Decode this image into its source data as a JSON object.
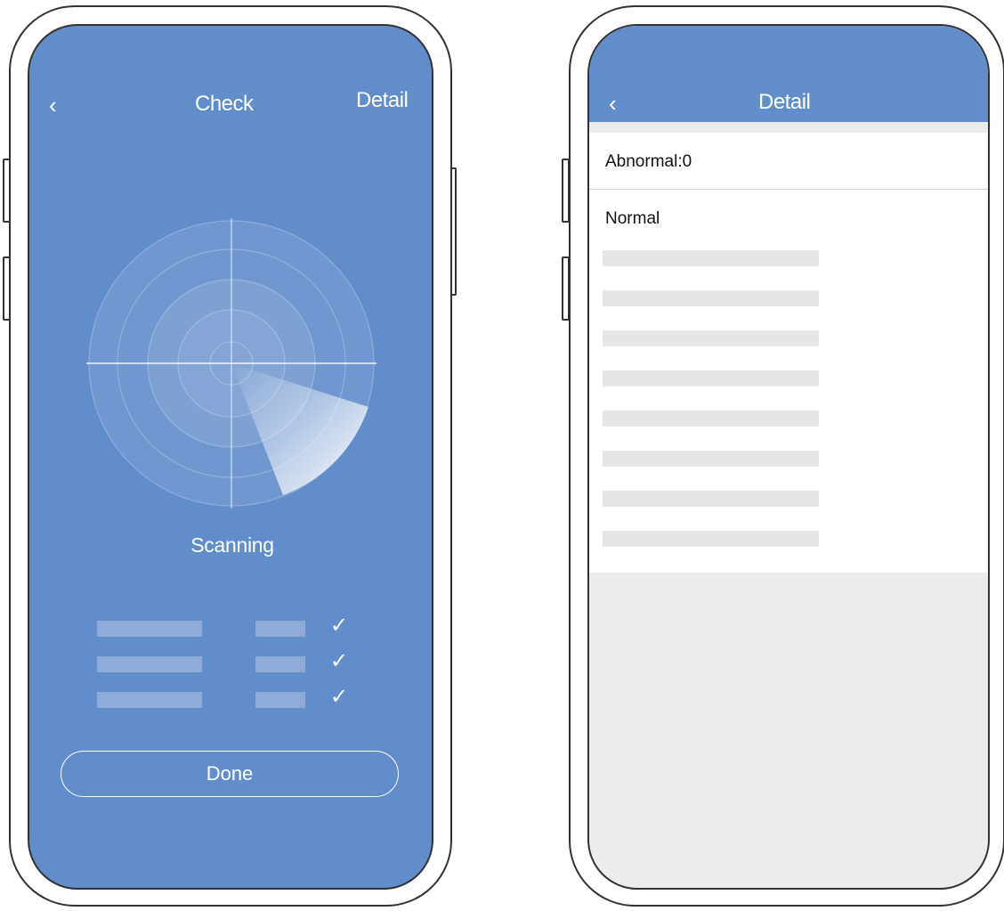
{
  "left_screen": {
    "nav": {
      "back_icon": "chevron-left-icon",
      "back_glyph": "‹",
      "title": "Check",
      "detail_link": "Detail"
    },
    "scanning_label": "Scanning",
    "check_items": [
      {
        "check_icon": "check-icon",
        "glyph": "✓"
      },
      {
        "check_icon": "check-icon",
        "glyph": "✓"
      },
      {
        "check_icon": "check-icon",
        "glyph": "✓"
      }
    ],
    "done_button": "Done"
  },
  "right_screen": {
    "nav": {
      "back_icon": "chevron-left-icon",
      "back_glyph": "‹",
      "title": "Detail"
    },
    "abnormal_label": "Abnormal:0",
    "normal_label": "Normal"
  },
  "colors": {
    "accent_blue": "#628dcb",
    "placeholder_gray": "#e6e6e6",
    "background_gray": "#ececec"
  }
}
